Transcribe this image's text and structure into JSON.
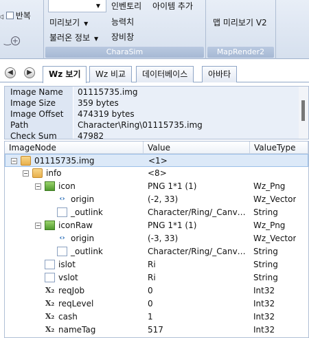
{
  "ribbon": {
    "repeat_label": "반복",
    "preview_label": "미리보기",
    "load_info_label": "불러온 정보",
    "inventory_label": "인벤토리",
    "item_add_label": "아이템 추가",
    "ability_label": "능력치",
    "equip_label": "장비창",
    "charasim_label": "CharaSim",
    "map_preview_label": "맵 미리보기 V2",
    "maprender_label": "MapRender2"
  },
  "tabs": [
    {
      "label": "Wz 보기",
      "active": true
    },
    {
      "label": "Wz 비교"
    },
    {
      "label": "데이터베이스"
    },
    {
      "label": "아바타"
    }
  ],
  "info": [
    {
      "key": "Image Name",
      "value": "01115735.img"
    },
    {
      "key": "Image Size",
      "value": "359 bytes"
    },
    {
      "key": "Image Offset",
      "value": "474319 bytes"
    },
    {
      "key": "Path",
      "value": "Character\\Ring\\01115735.img"
    },
    {
      "key": "Check Sum",
      "value": "47982"
    }
  ],
  "columns": [
    "ImageNode",
    "Value",
    "ValueType"
  ],
  "rows": [
    {
      "name": "01115735.img",
      "value": "<1>",
      "type": "",
      "icon": "folder-icon"
    },
    {
      "name": "info",
      "value": "<8>",
      "type": "",
      "icon": "folder-icon"
    },
    {
      "name": "icon",
      "value": "PNG 1*1 (1)",
      "type": "Wz_Png",
      "icon": "png-icon"
    },
    {
      "name": "origin",
      "value": "(-2, 33)",
      "type": "Wz_Vector",
      "icon": "vector-icon"
    },
    {
      "name": "_outlink",
      "value": "Character/Ring/_Canv…",
      "type": "String",
      "icon": "document-icon"
    },
    {
      "name": "iconRaw",
      "value": "PNG 1*1 (1)",
      "type": "Wz_Png",
      "icon": "png-icon"
    },
    {
      "name": "origin",
      "value": "(-3, 33)",
      "type": "Wz_Vector",
      "icon": "vector-icon"
    },
    {
      "name": "_outlink",
      "value": "Character/Ring/_Canv…",
      "type": "String",
      "icon": "document-icon"
    },
    {
      "name": "islot",
      "value": "Ri",
      "type": "String",
      "icon": "document-icon"
    },
    {
      "name": "vslot",
      "value": "Ri",
      "type": "String",
      "icon": "document-icon"
    },
    {
      "name": "reqJob",
      "value": "0",
      "type": "Int32",
      "icon": "int-icon"
    },
    {
      "name": "reqLevel",
      "value": "0",
      "type": "Int32",
      "icon": "int-icon"
    },
    {
      "name": "cash",
      "value": "1",
      "type": "Int32",
      "icon": "int-icon"
    },
    {
      "name": "nameTag",
      "value": "517",
      "type": "Int32",
      "icon": "int-icon"
    }
  ]
}
